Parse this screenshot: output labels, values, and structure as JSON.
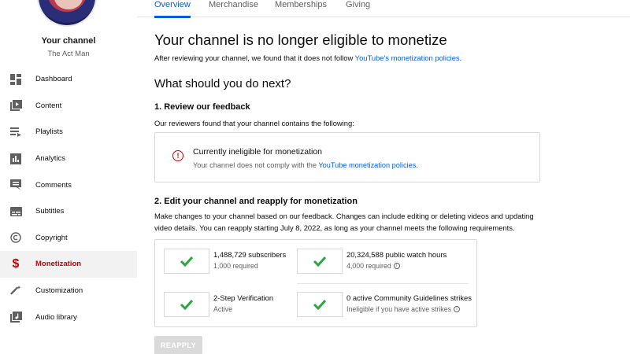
{
  "sidebar": {
    "title": "Your channel",
    "channel_name": "The Act Man",
    "items": [
      {
        "label": "Dashboard",
        "icon": "dashboard-icon"
      },
      {
        "label": "Content",
        "icon": "content-icon"
      },
      {
        "label": "Playlists",
        "icon": "playlists-icon"
      },
      {
        "label": "Analytics",
        "icon": "analytics-icon"
      },
      {
        "label": "Comments",
        "icon": "comments-icon"
      },
      {
        "label": "Subtitles",
        "icon": "subtitles-icon"
      },
      {
        "label": "Copyright",
        "icon": "copyright-icon"
      },
      {
        "label": "Monetization",
        "icon": "dollar-icon",
        "active": true
      },
      {
        "label": "Customization",
        "icon": "magic-wand-icon"
      },
      {
        "label": "Audio library",
        "icon": "audio-library-icon"
      }
    ]
  },
  "tabs": [
    "Overview",
    "Merchandise",
    "Memberships",
    "Giving"
  ],
  "main": {
    "heading": "Your channel is no longer eligible to monetize",
    "intro_text": "After reviewing your channel, we found that it does not follow ",
    "intro_link": "YouTube's monetization policies",
    "intro_end": ".",
    "next_heading": "What should you do next?",
    "step1_title": "1. Review our feedback",
    "step1_text": "Our reviewers found that your channel contains the following:",
    "feedback_title": "Currently ineligible for monetization",
    "feedback_text": "Your channel does not comply with the ",
    "feedback_link": "YouTube monetization policies",
    "feedback_end": ".",
    "step2_title": "2. Edit your channel and reapply for monetization",
    "step2_text": "Make changes to your channel based on our feedback. Changes can include editing or deleting videos and updating video details. You can reapply starting July 8, 2022, as long as your channel meets the following requirements.",
    "requirements": [
      {
        "title": "1,488,729 subscribers",
        "sub": "1,000 required",
        "info": false
      },
      {
        "title": "20,324,588 public watch hours",
        "sub": "4,000 required",
        "info": true
      },
      {
        "title": "2-Step Verification",
        "sub": "Active",
        "info": false
      },
      {
        "title": "0 active Community Guidelines strikes",
        "sub": "Ineligible if you have active strikes",
        "info": true
      }
    ],
    "reapply_label": "REAPPLY"
  },
  "colors": {
    "accent": "#065fd4",
    "active": "#cc0000",
    "check": "#2ba640"
  }
}
